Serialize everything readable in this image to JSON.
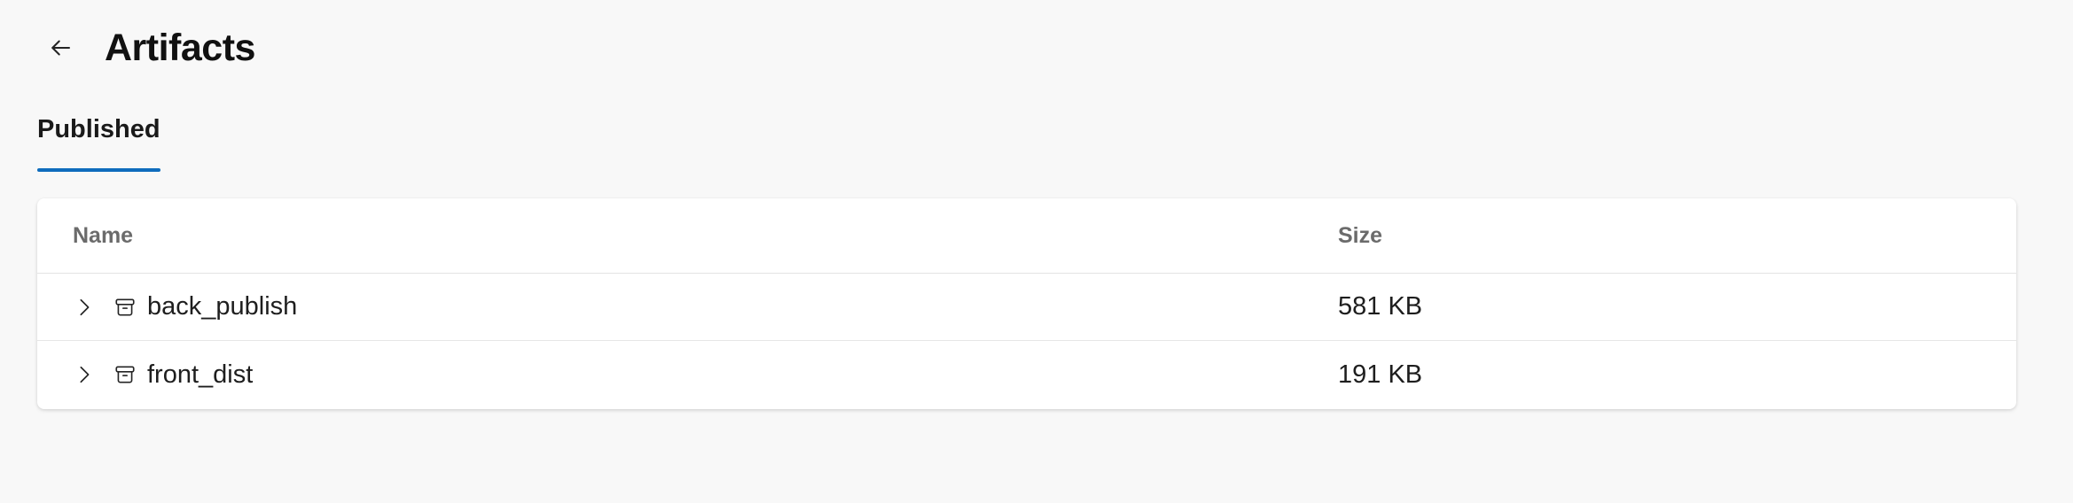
{
  "header": {
    "title": "Artifacts",
    "back_icon": "arrow-left-icon"
  },
  "tabs": [
    {
      "label": "Published",
      "selected": true
    }
  ],
  "table": {
    "columns": {
      "name": "Name",
      "size": "Size"
    },
    "rows": [
      {
        "name": "back_publish",
        "size": "581 KB",
        "expanded": false,
        "icon": "archive-icon"
      },
      {
        "name": "front_dist",
        "size": "191 KB",
        "expanded": false,
        "icon": "archive-icon"
      }
    ]
  },
  "colors": {
    "accent": "#0f6cbd",
    "page_background": "#f8f8f8",
    "card_background": "#ffffff",
    "header_text": "#6b6b6b"
  }
}
